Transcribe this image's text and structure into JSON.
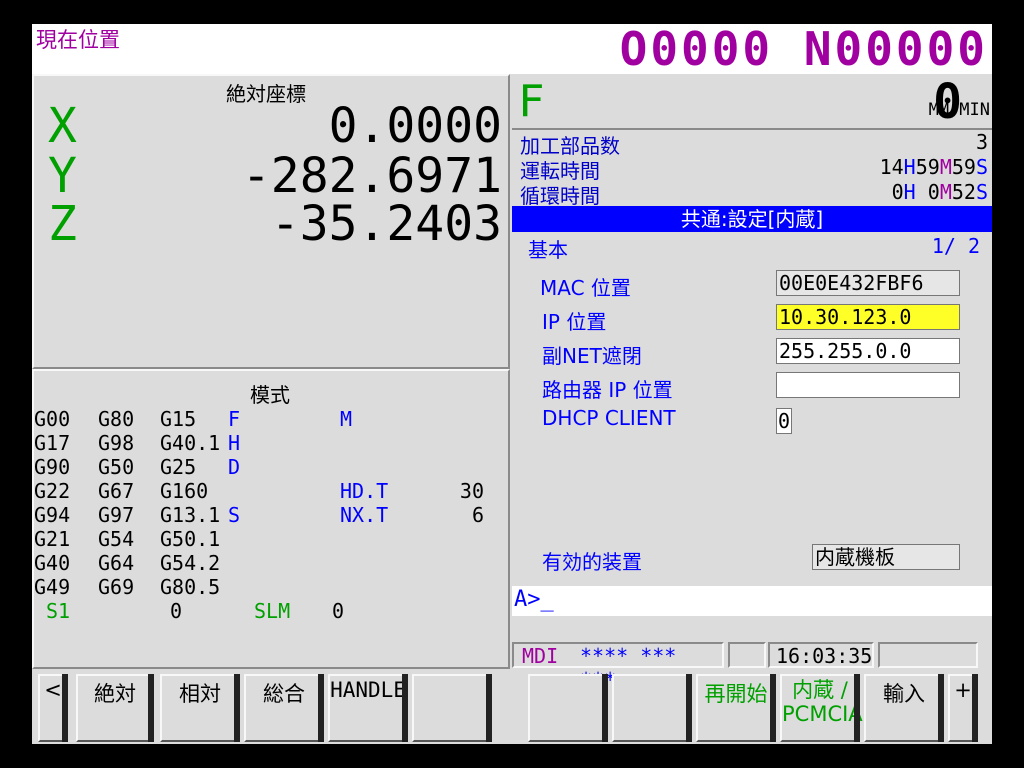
{
  "title_bar": {
    "screen_title": "現在位置",
    "program_number": "O0000 N00000"
  },
  "absolute": {
    "header": "絶対座標",
    "axes": [
      {
        "label": "X",
        "value": "0.0000"
      },
      {
        "label": "Y",
        "value": "-282.6971"
      },
      {
        "label": "Z",
        "value": "-35.2403"
      }
    ]
  },
  "modal": {
    "header": "模式",
    "rows": [
      [
        "G00",
        "G80",
        "G15",
        "F",
        "",
        "M",
        ""
      ],
      [
        "G17",
        "G98",
        "G40.1",
        "H",
        "",
        "",
        ""
      ],
      [
        "G90",
        "G50",
        "G25",
        "D",
        "",
        "",
        ""
      ],
      [
        "G22",
        "G67",
        "G160",
        "",
        "",
        "HD.T",
        "30"
      ],
      [
        "G94",
        "G97",
        "G13.1",
        "S",
        "",
        "NX.T",
        "6"
      ],
      [
        "G21",
        "G54",
        "G50.1",
        "",
        "",
        "",
        ""
      ],
      [
        "G40",
        "G64",
        "G54.2",
        "",
        "",
        "",
        ""
      ],
      [
        "G49",
        "G69",
        "G80.5",
        "",
        "",
        "",
        ""
      ]
    ],
    "spindle": {
      "label": "S1",
      "value": "0",
      "slm_label": "SLM",
      "slm_value": "0"
    }
  },
  "feed": {
    "letter": "F",
    "value": "0",
    "unit": "MM/MIN"
  },
  "stats": {
    "parts_label": "加工部品数",
    "parts_value": "3",
    "run_label": "運転時間",
    "run_h": "14",
    "run_m": "59",
    "run_s": "59",
    "cycle_label": "循環時間",
    "cycle_h": "0",
    "cycle_m": "0",
    "cycle_s": "52",
    "h_unit": "H",
    "m_unit": "M",
    "s_unit": "S"
  },
  "settings": {
    "header": "共通:設定[内蔵]",
    "section": "基本",
    "page": "1/ 2",
    "fields": [
      {
        "label": "MAC 位置",
        "value": "00E0E432FBF6"
      },
      {
        "label": "IP 位置",
        "value": "10.30.123.0"
      },
      {
        "label": "副NET遮閉",
        "value": "255.255.0.0"
      },
      {
        "label": "路由器 IP 位置",
        "value": ""
      },
      {
        "label": "DHCP CLIENT",
        "value": "0"
      }
    ],
    "device_label": "有効的装置",
    "device_value": "内蔵機板"
  },
  "input_prompt": "A>_",
  "status_bar": {
    "mode": "MDI",
    "status": "**** *** ***",
    "time": "16:03:35"
  },
  "softkeys_left": [
    "<",
    "絶対",
    "相対",
    "総合",
    "HANDLE",
    ""
  ],
  "softkeys_right": [
    "",
    "",
    "再開始",
    "内蔵 /\nPCMCIA",
    "輸入",
    "+"
  ],
  "colors": {
    "title_magenta": "#a000a0",
    "axis_green": "#00a000",
    "accent_blue": "#0000ff",
    "highlight_yellow": "#ffff28"
  }
}
